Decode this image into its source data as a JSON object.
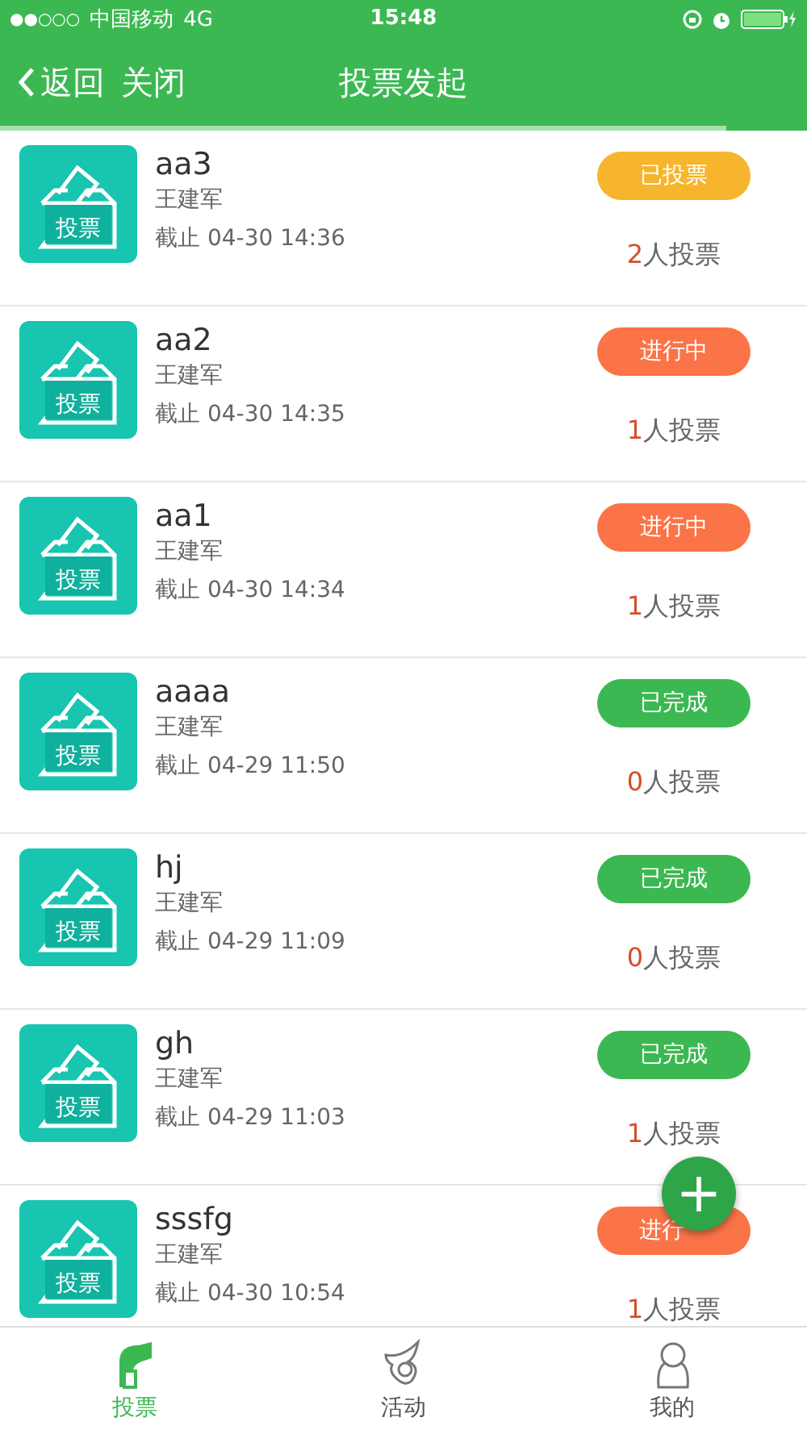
{
  "status_bar": {
    "signal": "●●○○○",
    "carrier": "中国移动",
    "network": "4G",
    "time": "15:48"
  },
  "nav_bar": {
    "back": "返回",
    "close": "关闭",
    "title": "投票发起"
  },
  "load_progress": {
    "level": 0.9
  },
  "polls": [
    {
      "title": "aa3",
      "author": "王建军",
      "deadline": "截止 04-30 14:36",
      "status": {
        "kind": "voted",
        "label": "已投票"
      },
      "count": "2",
      "count_label": "人投票",
      "icon_label": "投票"
    },
    {
      "title": "aa2",
      "author": "王建军",
      "deadline": "截止 04-30 14:35",
      "status": {
        "kind": "ongoing",
        "label": "进行中"
      },
      "count": "1",
      "count_label": "人投票",
      "icon_label": "投票"
    },
    {
      "title": "aa1",
      "author": "王建军",
      "deadline": "截止 04-30 14:34",
      "status": {
        "kind": "ongoing",
        "label": "进行中"
      },
      "count": "1",
      "count_label": "人投票",
      "icon_label": "投票"
    },
    {
      "title": "aaaa",
      "author": "王建军",
      "deadline": "截止 04-29 11:50",
      "status": {
        "kind": "done",
        "label": "已完成"
      },
      "count": "0",
      "count_label": "人投票",
      "icon_label": "投票"
    },
    {
      "title": "hj",
      "author": "王建军",
      "deadline": "截止 04-29 11:09",
      "status": {
        "kind": "done",
        "label": "已完成"
      },
      "count": "0",
      "count_label": "人投票",
      "icon_label": "投票"
    },
    {
      "title": "gh",
      "author": "王建军",
      "deadline": "截止 04-29 11:03",
      "status": {
        "kind": "done",
        "label": "已完成"
      },
      "count": "1",
      "count_label": "人投票",
      "icon_label": "投票"
    },
    {
      "title": "sssfg",
      "author": "王建军",
      "deadline": "截止 04-30 10:54",
      "status": {
        "kind": "ongoing",
        "label": "进行"
      },
      "count": "1",
      "count_label": "人投票",
      "icon_label": "投票"
    }
  ],
  "fab": {
    "label": "+"
  },
  "tab_bar": [
    {
      "label": "投票",
      "selected": true,
      "kind": "vote"
    },
    {
      "label": "活动",
      "selected": false,
      "kind": "activity"
    },
    {
      "label": "我的",
      "selected": false,
      "kind": "me"
    }
  ]
}
